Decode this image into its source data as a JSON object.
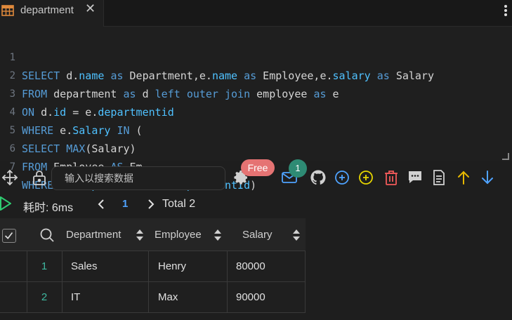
{
  "tab": {
    "title": "department",
    "close": "✕"
  },
  "editor": {
    "lines": [
      {
        "num": "1"
      },
      {
        "num": "2"
      },
      {
        "num": "3"
      },
      {
        "num": "4"
      },
      {
        "num": "5"
      },
      {
        "num": "6"
      },
      {
        "num": "7"
      }
    ],
    "sql": "SELECT d.name as Department,e.name as Employee,e.salary as Salary\nFROM department as d left outer join employee as e\nON d.id = e.departmentid\nWHERE e.Salary IN (\nSELECT MAX(Salary)\nFROM Employee AS Em\nWHERE Em.DepartmentId=e.DepartmentId)"
  },
  "toolbar": {
    "search_placeholder": "输入以搜索数据",
    "free_badge": "Free",
    "mail_count": "1",
    "icons": [
      "move-icon",
      "lock-icon",
      "gear-icon",
      "mail-icon",
      "github-icon",
      "add-circle-icon",
      "add-circle-yellow-icon",
      "trash-icon",
      "comment-icon",
      "document-icon",
      "arrow-up-icon",
      "arrow-down-icon"
    ]
  },
  "status": {
    "elapsed": "耗时: 6ms",
    "page": "1",
    "total": "Total 2"
  },
  "table": {
    "columns": [
      "Department",
      "Employee",
      "Salary"
    ],
    "rows": [
      {
        "num": "1",
        "Department": "Sales",
        "Employee": "Henry",
        "Salary": "80000"
      },
      {
        "num": "2",
        "Department": "IT",
        "Employee": "Max",
        "Salary": "90000"
      }
    ]
  },
  "colors": {
    "keyword": "#569cd6",
    "field": "#4fc1ff",
    "badge_free": "#e57373",
    "badge_count": "#2e8b74",
    "row_number": "#3fb8a0",
    "page_number": "#4fa3ff"
  }
}
